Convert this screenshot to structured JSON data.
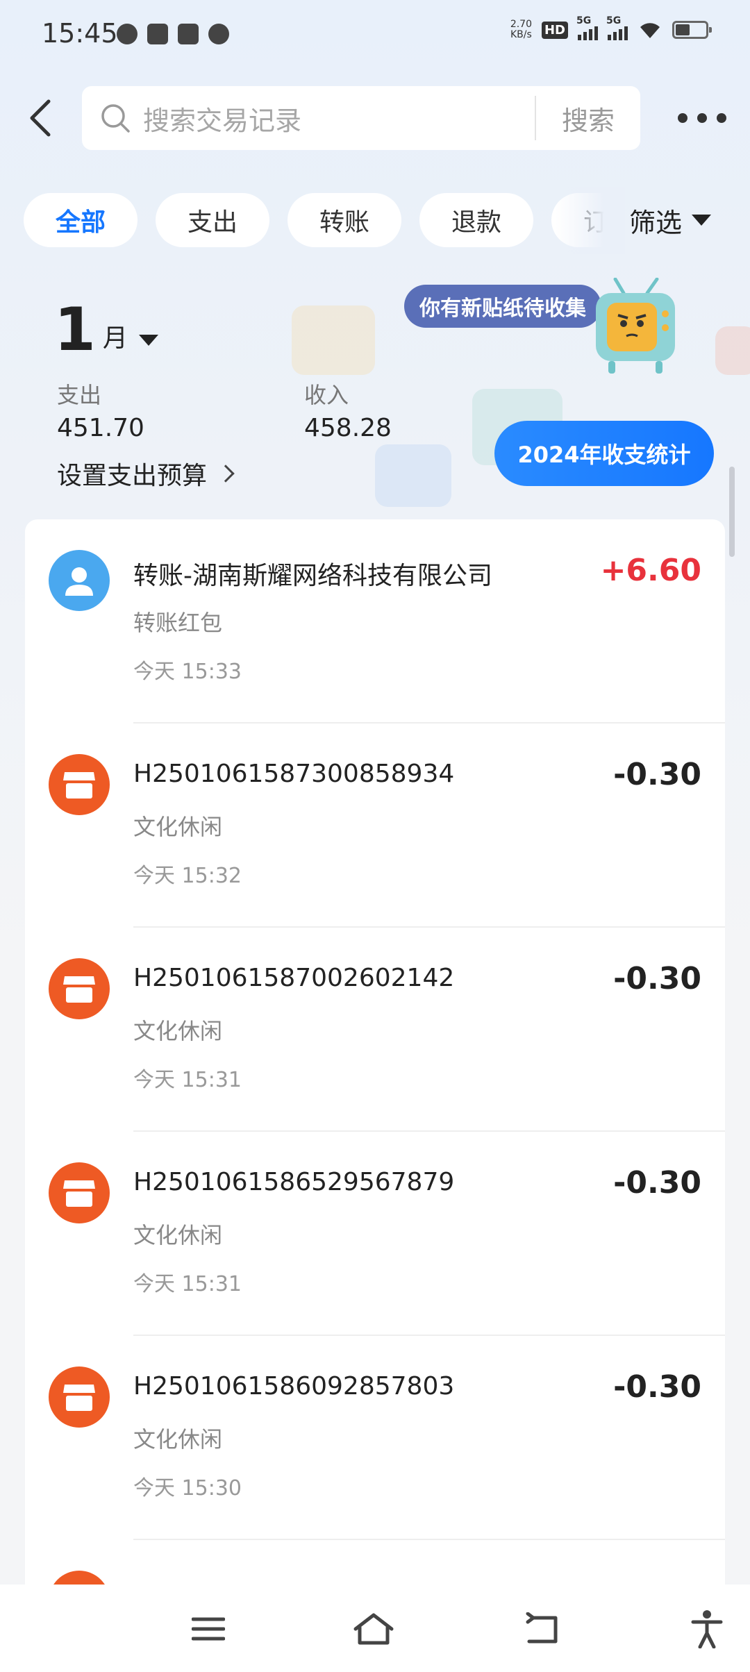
{
  "status_bar": {
    "time": "15:45",
    "net_speed_value": "2.70",
    "net_speed_unit": "KB/s",
    "hd_label": "HD",
    "signal_1": "5G",
    "signal_2": "5G"
  },
  "header": {
    "search_placeholder": "搜索交易记录",
    "search_button": "搜索"
  },
  "tabs": [
    {
      "label": "全部",
      "active": true
    },
    {
      "label": "支出",
      "active": false
    },
    {
      "label": "转账",
      "active": false
    },
    {
      "label": "退款",
      "active": false
    },
    {
      "label": "订单",
      "active": false
    }
  ],
  "filter_label": "筛选",
  "summary": {
    "month_number": "1",
    "month_unit": "月",
    "expense_label": "支出",
    "expense_value": "451.70",
    "income_label": "收入",
    "income_value": "458.28",
    "budget_link": "设置支出预算",
    "sticker_notice": "你有新贴纸待收集",
    "stats_button": "2024年收支统计"
  },
  "transactions": [
    {
      "title": "转账-湖南斯耀网络科技有限公司",
      "category": "转账红包",
      "time": "今天 15:33",
      "amount": "+6.60",
      "icon": "person-icon"
    },
    {
      "title": "H2501061587300858934",
      "category": "文化休闲",
      "time": "今天 15:32",
      "amount": "-0.30",
      "icon": "shop-icon"
    },
    {
      "title": "H2501061587002602142",
      "category": "文化休闲",
      "time": "今天 15:31",
      "amount": "-0.30",
      "icon": "shop-icon"
    },
    {
      "title": "H2501061586529567879",
      "category": "文化休闲",
      "time": "今天 15:31",
      "amount": "-0.30",
      "icon": "shop-icon"
    },
    {
      "title": "H2501061586092857803",
      "category": "文化休闲",
      "time": "今天 15:30",
      "amount": "-0.30",
      "icon": "shop-icon"
    }
  ],
  "colors": {
    "accent": "#1677ff",
    "income_red": "#e8323c",
    "shop_orange": "#ee5a24",
    "person_blue": "#4aa8ef"
  }
}
